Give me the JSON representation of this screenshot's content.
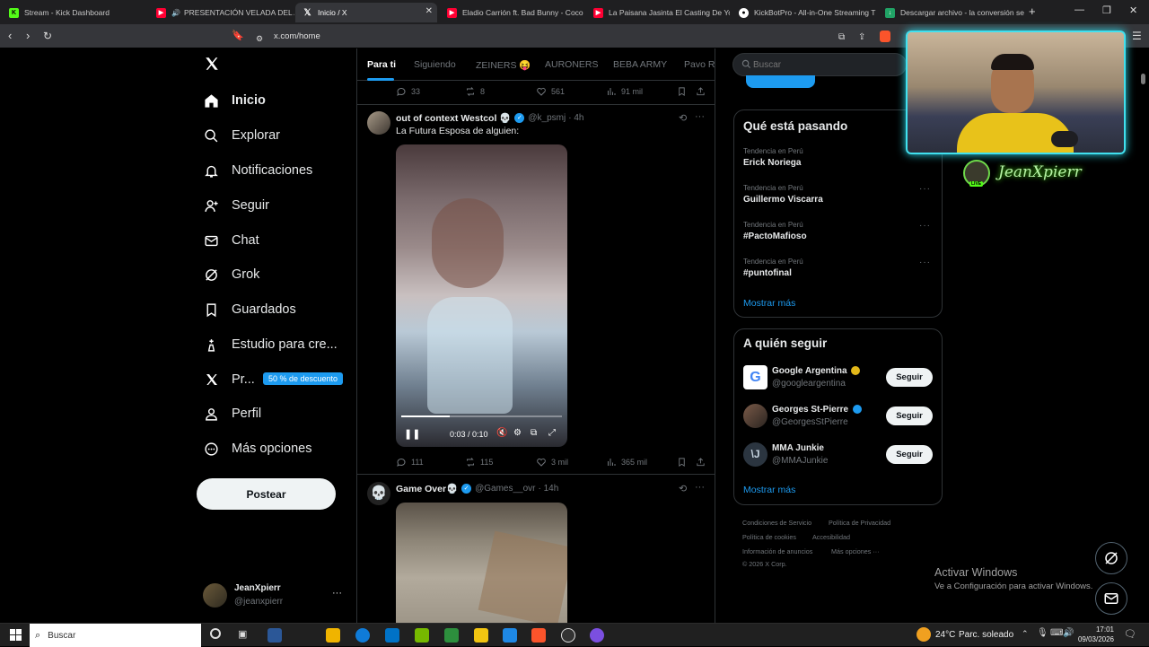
{
  "browser": {
    "tabs": [
      {
        "title": "Stream - Kick Dashboard",
        "favicon_color": "#53fc18"
      },
      {
        "title": "PRESENTACIÓN VELADA DEL AÑ",
        "favicon_color": "#ff0033"
      },
      {
        "title": "Inicio / X",
        "favicon_color": "#ffffff"
      },
      {
        "title": "Eladio Carrión ft. Bad Bunny - Coco",
        "favicon_color": "#ff0033"
      },
      {
        "title": "La Paisana Jasinta El Casting De Yo S",
        "favicon_color": "#ff0033"
      },
      {
        "title": "KickBotPro - All-in-One Streaming T",
        "favicon_color": "#ffffff"
      },
      {
        "title": "Descargar archivo - la conversión se",
        "favicon_color": "#21a366"
      }
    ],
    "new_tab": "+",
    "url": "x.com/home"
  },
  "sidebar": {
    "logo": "X",
    "items": [
      {
        "label": "Inicio",
        "icon": "home-icon"
      },
      {
        "label": "Explorar",
        "icon": "search-icon"
      },
      {
        "label": "Notificaciones",
        "icon": "bell-icon"
      },
      {
        "label": "Seguir",
        "icon": "add-user-icon"
      },
      {
        "label": "Chat",
        "icon": "mail-icon"
      },
      {
        "label": "Grok",
        "icon": "grok-icon"
      },
      {
        "label": "Guardados",
        "icon": "bookmark-icon"
      },
      {
        "label": "Estudio para cre...",
        "icon": "creator-studio-icon"
      },
      {
        "label": "Pr...",
        "icon": "x-premium-icon"
      },
      {
        "label": "Perfil",
        "icon": "person-icon"
      },
      {
        "label": "Más opciones",
        "icon": "more-circle-icon"
      }
    ],
    "promo_badge": "50 % de descuento",
    "post_button": "Postear",
    "account": {
      "name": "JeanXpierr",
      "handle": "@jeanxpierr",
      "more": "···"
    }
  },
  "feed": {
    "tabs": [
      "Para ti",
      "Siguiendo",
      "ZEINERS 😝",
      "AURONERS",
      "BEBA ARMY",
      "Pavo Ra"
    ],
    "top_actions": {
      "replies": "33",
      "reposts": "8",
      "likes": "561",
      "views": "91 mil"
    },
    "tweet1": {
      "name": "out of context Westcol 💀",
      "handle": "@k_psmj",
      "time": "· 4h",
      "text": "La Futura Esposa de alguien:",
      "video_time": "0:03 / 0:10",
      "video_progress": 0.3,
      "actions": {
        "replies": "111",
        "reposts": "115",
        "likes": "3 mil",
        "views": "365 mil"
      }
    },
    "tweet2": {
      "name": "Game Over💀",
      "handle": "@Games__ovr",
      "time": "· 14h"
    }
  },
  "right": {
    "search_placeholder": "Buscar",
    "trends_title": "Qué está pasando",
    "trends": [
      {
        "context": "Tendencia en Perú",
        "name": "Erick Noriega"
      },
      {
        "context": "Tendencia en Perú",
        "name": "Guillermo Viscarra"
      },
      {
        "context": "Tendencia en Perú",
        "name": "#PactoMafioso"
      },
      {
        "context": "Tendencia en Perú",
        "name": "#puntofinal"
      }
    ],
    "show_more": "Mostrar más",
    "follow_title": "A quién seguir",
    "follow": [
      {
        "name": "Google Argentina",
        "handle": "@googleargentina",
        "button": "Seguir"
      },
      {
        "name": "Georges St-Pierre",
        "handle": "@GeorgesStPierre",
        "button": "Seguir"
      },
      {
        "name": "MMA Junkie",
        "handle": "@MMAJunkie",
        "button": "Seguir"
      }
    ],
    "footer": {
      "l1a": "Condiciones de Servicio",
      "l1b": "Política de Privacidad",
      "l2a": "Política de cookies",
      "l2b": "Accesibilidad",
      "l3a": "Información de anuncios",
      "l3b": "Más opciones ···",
      "copyright": "© 2026 X Corp."
    }
  },
  "overlay": {
    "streamer_name": "JeanXpierr",
    "live_badge": "LIVE",
    "activate_title": "Activar Windows",
    "activate_sub": "Ve a Configuración para activar Windows."
  },
  "taskbar": {
    "search_placeholder": "Buscar",
    "weather_temp": "24°C",
    "weather_desc": "Parc. soleado",
    "time": "17:01",
    "date": "09/03/2026"
  }
}
